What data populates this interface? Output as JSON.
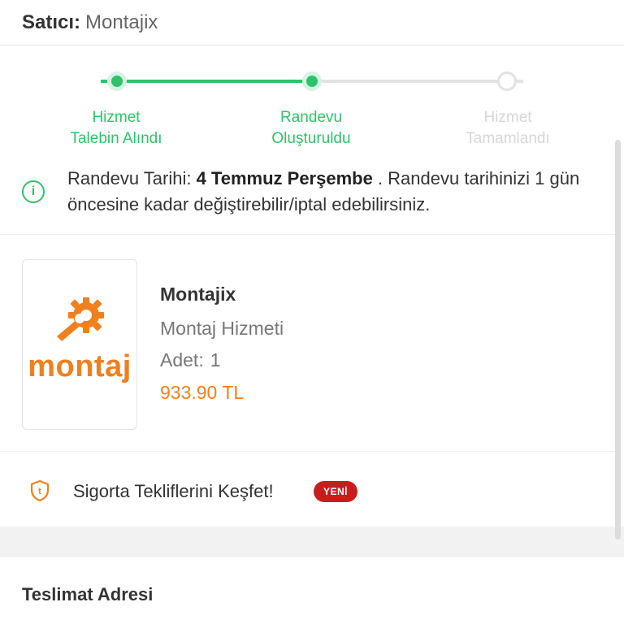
{
  "seller": {
    "label": "Satıcı:",
    "name": "Montajix"
  },
  "stepper": {
    "steps": [
      {
        "label": "Hizmet\nTalebin Alındı",
        "state": "done"
      },
      {
        "label": "Randevu\nOluşturuldu",
        "state": "done"
      },
      {
        "label": "Hizmet\nTamamlandı",
        "state": "pending"
      }
    ]
  },
  "info": {
    "prefix": "Randevu Tarihi: ",
    "date": "4 Temmuz Perşembe",
    "suffix": " . Randevu tarihinizi 1 gün öncesine kadar değiştirebilir/iptal edebilirsiniz.",
    "icon": "info-icon"
  },
  "product": {
    "logo_text": "montaj",
    "name": "Montajix",
    "type": "Montaj Hizmeti",
    "qty_label": "Adet:",
    "qty": "1",
    "price": "933.90 TL"
  },
  "insurance": {
    "label": "Sigorta Tekliflerini Keşfet!",
    "badge": "YENİ",
    "icon": "shield-icon"
  },
  "address": {
    "title": "Teslimat Adresi"
  },
  "colors": {
    "green": "#2ec26a",
    "orange": "#f07f1e",
    "badge_red": "#c81d1d"
  }
}
